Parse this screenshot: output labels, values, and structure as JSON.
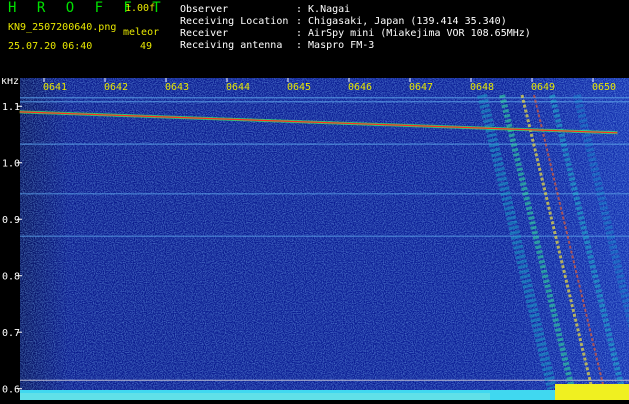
{
  "header": {
    "app_name": "H R O F F T",
    "version": "1.00f",
    "filename": "KN9_2507200640.png",
    "program": "meleor",
    "datetime": "25.07.20 06:40",
    "count": "49",
    "info": [
      {
        "label": "Observer",
        "value": ": K.Nagai"
      },
      {
        "label": "Receiving Location",
        "value": ": Chigasaki, Japan (139.414 35.340)"
      },
      {
        "label": "Receiver",
        "value": ": AirSpy mini (Miakejima VOR 108.65MHz)"
      },
      {
        "label": "Receiving antenna",
        "value": ": Maspro FM-3"
      }
    ]
  },
  "colors": {
    "background": "#000000",
    "spectro_bg": "#0a1a8c",
    "accent_yellow": "#e8e800",
    "title_green": "#00e000",
    "trace_red": "#ff3020",
    "trace_green": "#40ff60"
  },
  "chart_data": {
    "type": "heatmap",
    "yunit": "kHz",
    "x_ticks": [
      "0641",
      "0642",
      "0643",
      "0644",
      "0645",
      "0646",
      "0647",
      "0648",
      "0649",
      "0650"
    ],
    "y_ticks": [
      "1.1",
      "1.0",
      "0.9",
      "0.8",
      "0.7",
      "0.6"
    ],
    "ylim": [
      0.58,
      1.15
    ],
    "horizontal_lines_khz": [
      1.115,
      1.108,
      1.033,
      0.945,
      0.87,
      0.615,
      0.595
    ],
    "carrier_trace": {
      "x_start": "0640.6",
      "x_end": "0650.4",
      "khz_start": 1.09,
      "khz_end": 1.053
    },
    "meteor_echo": {
      "time": "0649",
      "khz_top": 1.12,
      "khz_bottom": 0.6
    }
  }
}
